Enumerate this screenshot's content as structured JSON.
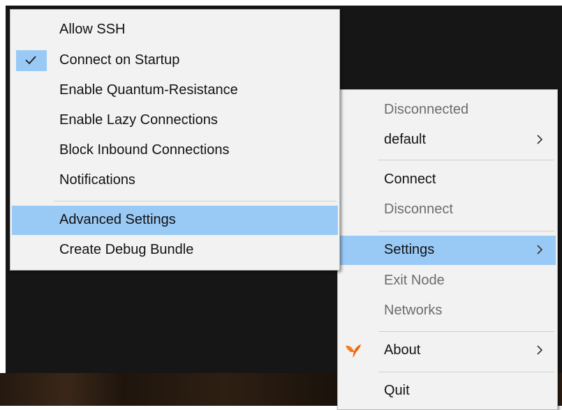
{
  "settings_submenu": {
    "items": [
      {
        "label": "Allow SSH",
        "checked": false
      },
      {
        "label": "Connect on Startup",
        "checked": true
      },
      {
        "label": "Enable Quantum-Resistance",
        "checked": false
      },
      {
        "label": "Enable Lazy Connections",
        "checked": false
      },
      {
        "label": "Block Inbound Connections",
        "checked": false
      },
      {
        "label": "Notifications",
        "checked": false
      }
    ],
    "advanced": {
      "label": "Advanced Settings",
      "highlighted": true
    },
    "debug": {
      "label": "Create Debug Bundle"
    }
  },
  "tray_menu": {
    "status": "Disconnected",
    "profile": "default",
    "connect": "Connect",
    "disconnect": "Disconnect",
    "settings": "Settings",
    "exit_node": "Exit Node",
    "networks": "Networks",
    "about": "About",
    "quit": "Quit"
  },
  "colors": {
    "highlight": "#99c9f5",
    "menu_bg": "#f2f2f2",
    "disabled_text": "#6d6d6d",
    "about_icon": "#f47b20"
  },
  "icons": {
    "check": "checkmark-icon",
    "chevron": "chevron-right-icon",
    "about": "netbird-logo-icon"
  }
}
